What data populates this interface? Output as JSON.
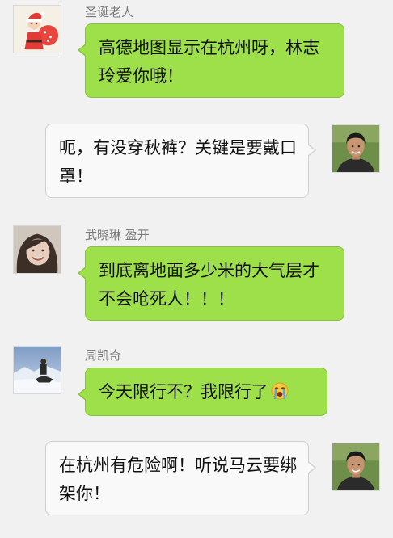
{
  "chat": {
    "messages": [
      {
        "side": "left",
        "sender": "圣诞老人",
        "avatar_icon": "santa-avatar",
        "text": "高德地图显示在杭州呀，林志玲爱你哦！"
      },
      {
        "side": "right",
        "sender": "",
        "avatar_icon": "self-avatar",
        "text": "呃，有没穿秋裤？关键是要戴口罩！"
      },
      {
        "side": "left",
        "sender": "武晓琳 盈开",
        "avatar_icon": "girl-avatar",
        "text": "到底离地面多少米的大气层才不会呛死人！！！"
      },
      {
        "side": "left",
        "sender": "周凯奇",
        "avatar_icon": "snow-landscape-avatar",
        "text": "今天限行不？我限行了",
        "emoji": "crying-face-icon"
      },
      {
        "side": "right",
        "sender": "",
        "avatar_icon": "self-avatar",
        "text": "在杭州有危险啊！听说马云要绑架你！"
      }
    ]
  },
  "colors": {
    "background": "#f1f1f1",
    "outgoing_bubble": "#9ee049",
    "incoming_bubble": "#f9f9f9",
    "name_text": "#7a7a7a"
  }
}
